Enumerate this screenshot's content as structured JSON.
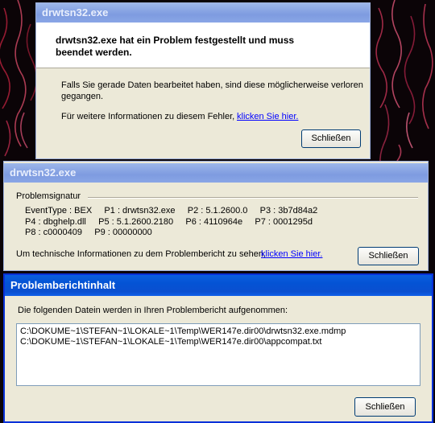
{
  "dialog1": {
    "title": "drwtsn32.exe",
    "headline_line1": "drwtsn32.exe hat ein Problem festgestellt und muss",
    "headline_line2": "beendet werden.",
    "info_line1": "Falls Sie gerade Daten bearbeitet haben, sind diese möglicherweise verloren",
    "info_line2": "gegangen.",
    "more_info_text": "Für weitere Informationen zu diesem Fehler,",
    "more_info_link": "klicken Sie hier.",
    "close_label": "Schließen"
  },
  "dialog2": {
    "title": "drwtsn32.exe",
    "signature_header": "Problemsignatur",
    "sig_line1": "EventType : BEX     P1 : drwtsn32.exe     P2 : 5.1.2600.0     P3 : 3b7d84a2",
    "sig_line2": "P4 : dbghelp.dll     P5 : 5.1.2600.2180     P6 : 4110964e     P7 : 0001295d",
    "sig_line3": "P8 : c0000409     P9 : 00000000",
    "tech_info_text": "Um technische Informationen zu dem Problembericht zu sehen,",
    "tech_info_link": "klicken Sie hier.",
    "close_label": "Schließen"
  },
  "dialog3": {
    "title": "Problemberichtinhalt",
    "description": "Die folgenden Datein werden in Ihren Problembericht aufgenommen:",
    "files": [
      "C:\\DOKUME~1\\STEFAN~1\\LOKALE~1\\Temp\\WER147e.dir00\\drwtsn32.exe.mdmp",
      "C:\\DOKUME~1\\STEFAN~1\\LOKALE~1\\Temp\\WER147e.dir00\\appcompat.txt"
    ],
    "close_label": "Schließen"
  }
}
